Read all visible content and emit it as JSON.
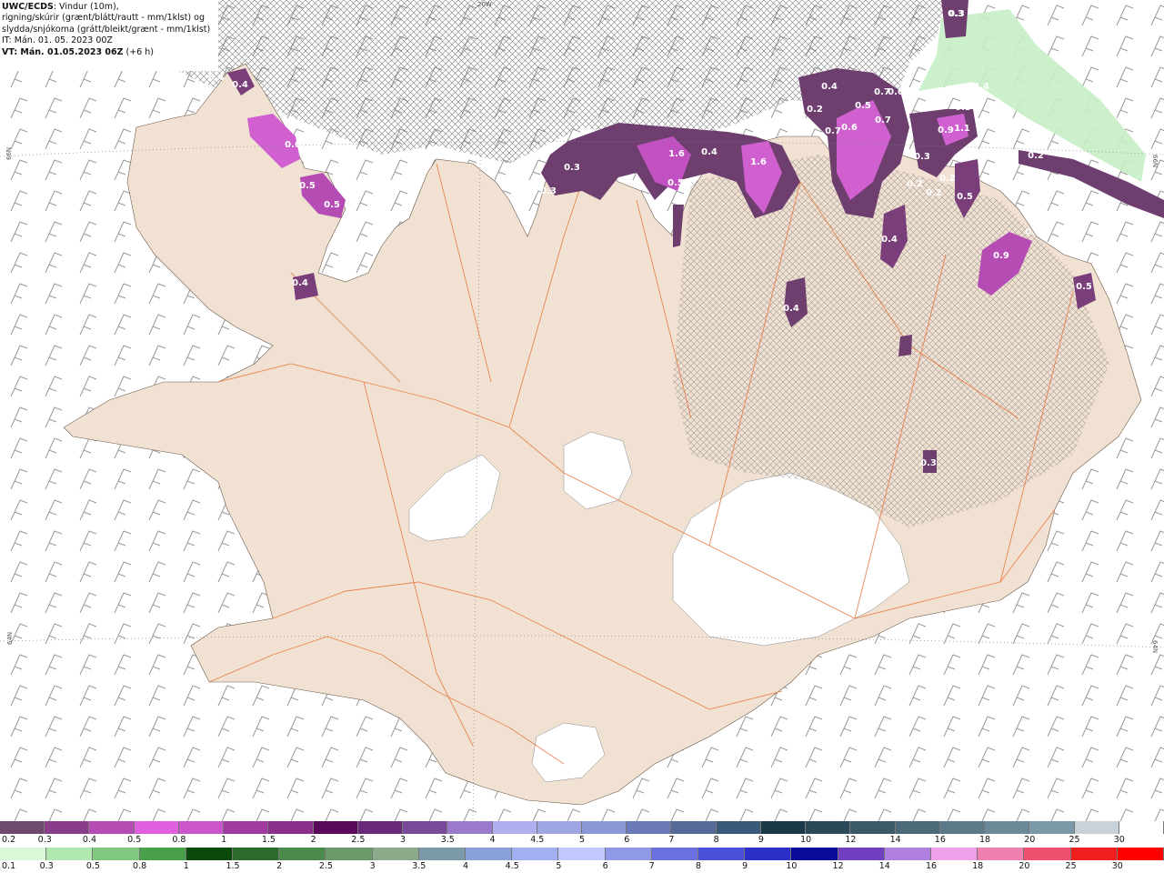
{
  "header": {
    "line1_bold": "UWC/ECDS",
    "line1_rest": ": Vindur (10m),",
    "line2": "rigning/skúrir (grænt/blátt/rautt - mm/1klst) og",
    "line3": "slydda/snjókoma (grátt/bleikt/grænt - mm/1klst)",
    "line4": "IT: Mán. 01. 05. 2023 00Z",
    "line5_bold": "VT: Mán. 01.05.2023 06Z",
    "line5_rest": " (+6 h)"
  },
  "graticule": {
    "top_label": "20W",
    "left_top": "66N",
    "right_top": "66N",
    "left_bottom": "64N",
    "right_bottom": "64N"
  },
  "precip_labels": [
    "0.3",
    "0.4",
    "0.3",
    "0.4",
    "0.6",
    "0.5",
    "0.5",
    "0.4",
    "0.4",
    "0.5",
    "0.7",
    "0.6",
    "0.2",
    "0.6",
    "0.7",
    "0.7",
    "0.9",
    "1.1",
    "0.4",
    "0.3",
    "0.2",
    "0.2",
    "0.5",
    "1.6",
    "0.4",
    "1.6",
    "0.7",
    "0.5",
    "0.3",
    "0.2",
    "0.3",
    "0.3",
    "0.9",
    "0.3",
    "0.5",
    "0.4",
    "0.3",
    "0.4",
    "0.2"
  ],
  "legend_snow": {
    "labels": [
      "0.2",
      "0.3",
      "0.4",
      "0.5",
      "0.8",
      "1",
      "1.5",
      "2",
      "2.5",
      "3",
      "3.5",
      "4",
      "4.5",
      "5",
      "6",
      "7",
      "8",
      "9",
      "10",
      "12",
      "14",
      "16",
      "18",
      "20",
      "25",
      "30"
    ],
    "colors": [
      "#6e4b6e",
      "#8a3e8a",
      "#b44cb4",
      "#e060e0",
      "#cc55cc",
      "#a13aa1",
      "#8c2e8c",
      "#5a0a5a",
      "#6a2a7a",
      "#7a4a9a",
      "#9a7acc",
      "#b0b0f0",
      "#9ea6e4",
      "#8c98d6",
      "#6a7ab8",
      "#566a9a",
      "#3a5a7a",
      "#1a3a4a",
      "#2a4a5a",
      "#3a5a6a",
      "#4a6a7a",
      "#5a7a8a",
      "#6a8a9a",
      "#7a9aaa",
      "#c8d2d8",
      "#ffffff"
    ]
  },
  "legend_rain": {
    "labels": [
      "0.1",
      "0.3",
      "0.5",
      "0.8",
      "1",
      "1.5",
      "2",
      "2.5",
      "3",
      "3.5",
      "4",
      "4.5",
      "5",
      "6",
      "7",
      "8",
      "9",
      "10",
      "12",
      "14",
      "16",
      "18",
      "20",
      "25",
      "30"
    ],
    "colors": [
      "#d8f8d8",
      "#b0e8b0",
      "#80c880",
      "#4aa04a",
      "#0a4a0a",
      "#2a6a2a",
      "#4a8a4a",
      "#6a9a6a",
      "#8aaa8a",
      "#7a9aaa",
      "#8aa0d8",
      "#a0b0f0",
      "#c0c8ff",
      "#9098e8",
      "#6a70e0",
      "#4a50d8",
      "#2a30c8",
      "#0a0a9a",
      "#7040c0",
      "#b080e0",
      "#f0a0e8",
      "#f080b0",
      "#f05070",
      "#f02020",
      "#ff0000"
    ]
  }
}
